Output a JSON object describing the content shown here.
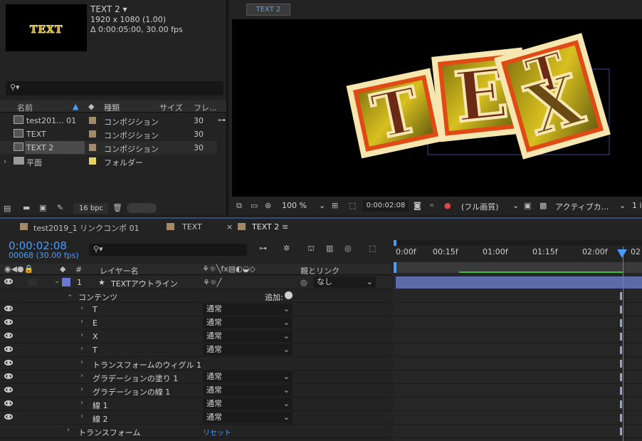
{
  "project": {
    "comp_name": "TEXT 2 ▾",
    "comp_res": "1920 x 1080 (1.00)",
    "comp_duration": "Δ 0:00:05:00, 30.00 fps",
    "thumb_text": "TEXT",
    "columns": {
      "name": "名前",
      "type": "種類",
      "size": "サイズ",
      "frames": "フレ..."
    },
    "items": [
      {
        "name": "test201... 01",
        "type": "コンポジション",
        "frames": "30",
        "color": "#a08a6a"
      },
      {
        "name": "TEXT",
        "type": "コンポジション",
        "frames": "30",
        "color": "#a08a6a"
      },
      {
        "name": "TEXT 2",
        "type": "コンポジション",
        "frames": "30",
        "color": "#a08a6a"
      },
      {
        "name": "平面",
        "type": "フォルダー",
        "frames": "",
        "color": "#e6d55a"
      }
    ],
    "bpc": "16 bpc"
  },
  "viewer": {
    "tab": "TEXT 2",
    "letters": [
      "T",
      "E",
      "X"
    ],
    "zoom": "100 %",
    "timecode": "0:00:02:08",
    "quality": "(フル画質)",
    "camera": "アクティブカ...",
    "views": "1 i"
  },
  "timeline": {
    "tabs": [
      "test2019_1 リンクコンポ 01",
      "TEXT",
      "TEXT 2"
    ],
    "close_glyph": "×",
    "menu_glyph": "≡",
    "timecode": "0:00:02:08",
    "frame_info": "00068 (30.00 fps)",
    "col_layer_name": "レイヤー名",
    "col_parent": "親とリンク",
    "hash": "#",
    "ruler_labels": [
      "0:00f",
      "00:15f",
      "01:00f",
      "01:15f",
      "02:00f",
      "02"
    ],
    "layer": {
      "index": "1",
      "star": "★",
      "name": "TEXTアウトライン",
      "parent": "なし"
    },
    "contents_label": "コンテンツ",
    "add_label": "追加:",
    "rows": [
      {
        "name": "T",
        "mode": "通常"
      },
      {
        "name": "E",
        "mode": "通常"
      },
      {
        "name": "X",
        "mode": "通常"
      },
      {
        "name": "T",
        "mode": "通常"
      },
      {
        "name": "トランスフォームのウィグル 1",
        "mode": ""
      },
      {
        "name": "グラデーションの塗り 1",
        "mode": "通常"
      },
      {
        "name": "グラデーションの線 1",
        "mode": "通常"
      },
      {
        "name": "線 1",
        "mode": "通常"
      },
      {
        "name": "線 2",
        "mode": "通常"
      }
    ],
    "transform_label": "トランスフォーム",
    "reset_label": "リセット",
    "playhead_fraction": 0.93
  }
}
